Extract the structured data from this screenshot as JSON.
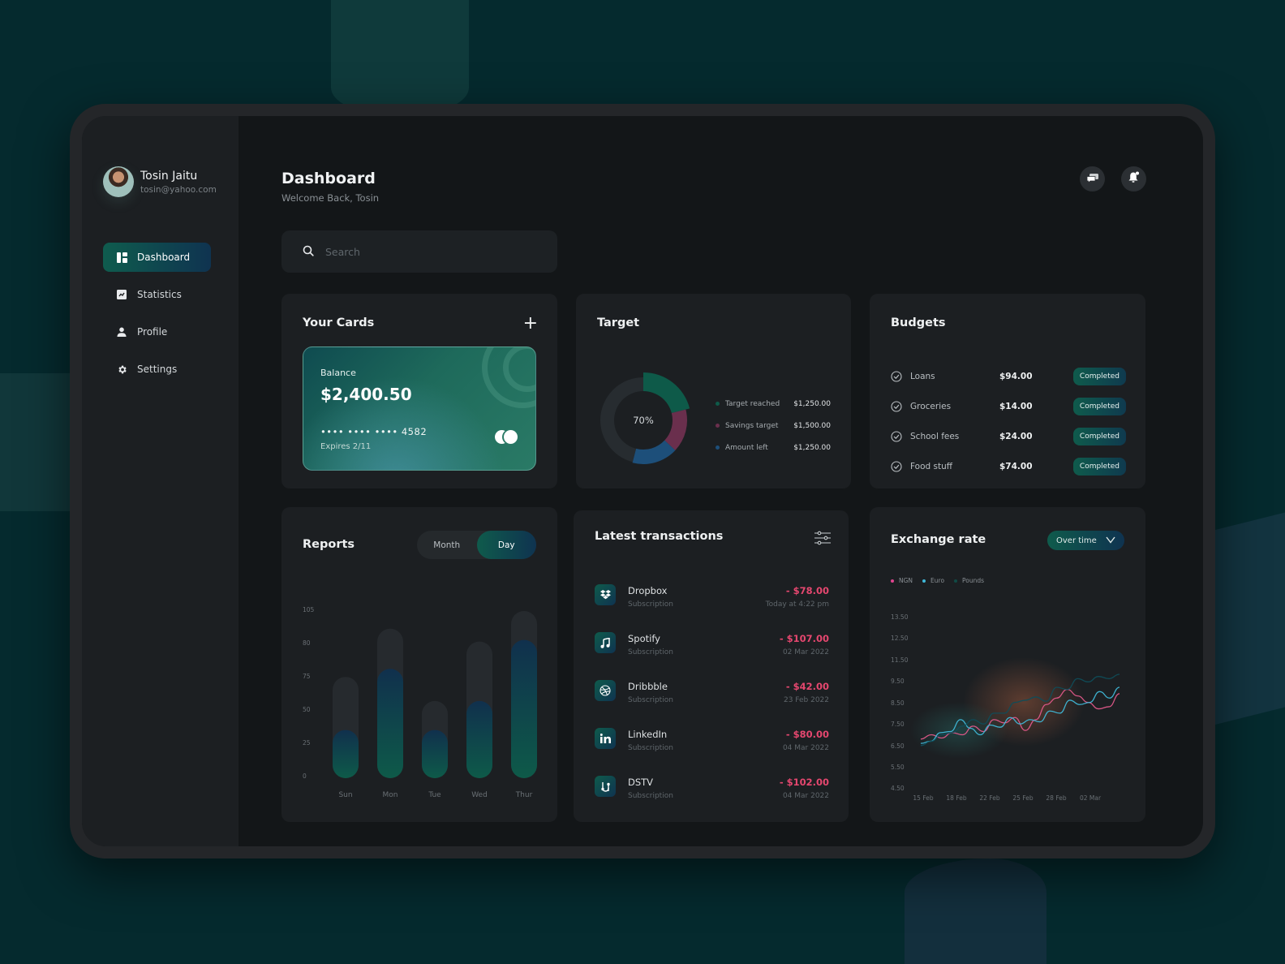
{
  "user": {
    "name": "Tosin Jaitu",
    "email": "tosin@yahoo.com"
  },
  "sidebar": {
    "items": [
      {
        "label": "Dashboard",
        "icon": "dashboard-icon",
        "active": true
      },
      {
        "label": "Statistics",
        "icon": "statistics-icon",
        "active": false
      },
      {
        "label": "Profile",
        "icon": "profile-icon",
        "active": false
      },
      {
        "label": "Settings",
        "icon": "settings-icon",
        "active": false
      }
    ]
  },
  "header": {
    "title": "Dashboard",
    "subtitle": "Welcome Back, Tosin",
    "icons": [
      "chat-icon",
      "notification-bell-icon"
    ]
  },
  "search": {
    "placeholder": "Search",
    "value": ""
  },
  "cards": {
    "title": "Your Cards",
    "add_label": "+",
    "card": {
      "balance_label": "Balance",
      "balance": "$2,400.50",
      "number": "•••• •••• •••• 4582",
      "expiry": "Expires 2/11",
      "brand_icon": "mastercard-icon"
    }
  },
  "target": {
    "title": "Target",
    "center_label": "70%",
    "legend": [
      {
        "label": "Target reached",
        "value": "$1,250.00",
        "color": "#0e5a49"
      },
      {
        "label": "Savings target",
        "value": "$1,500.00",
        "color": "#6a2f4d"
      },
      {
        "label": "Amount left",
        "value": "$1,250.00",
        "color": "#1d4f7a"
      }
    ],
    "segments": [
      {
        "name": "Target reached",
        "fraction": 0.21,
        "color": "#0e5a49",
        "offset": 0.0
      },
      {
        "name": "Savings target",
        "fraction": 0.16,
        "color": "#6a2f4d",
        "offset": 0.21
      },
      {
        "name": "Amount left",
        "fraction": 0.17,
        "color": "#1d4f7a",
        "offset": 0.37
      },
      {
        "name": "Remaining",
        "fraction": 0.46,
        "color": "#272c30",
        "offset": 0.54
      }
    ]
  },
  "budgets": {
    "title": "Budgets",
    "items": [
      {
        "name": "Loans",
        "amount": "$94.00",
        "status": "Completed"
      },
      {
        "name": "Groceries",
        "amount": "$14.00",
        "status": "Completed"
      },
      {
        "name": "School fees",
        "amount": "$24.00",
        "status": "Completed"
      },
      {
        "name": "Food stuff",
        "amount": "$74.00",
        "status": "Completed"
      }
    ]
  },
  "reports": {
    "title": "Reports",
    "toggle": [
      {
        "label": "Month",
        "active": false
      },
      {
        "label": "Day",
        "active": true
      }
    ]
  },
  "transactions": {
    "title": "Latest transactions",
    "items": [
      {
        "name": "Dropbox",
        "type": "Subscription",
        "amount": "- $78.00",
        "date": "Today at 4:22 pm",
        "icon": "dropbox-icon"
      },
      {
        "name": "Spotify",
        "type": "Subscription",
        "amount": "- $107.00",
        "date": "02 Mar 2022",
        "icon": "music-note-icon"
      },
      {
        "name": "Dribbble",
        "type": "Subscription",
        "amount": "- $42.00",
        "date": "23 Feb 2022",
        "icon": "dribbble-icon"
      },
      {
        "name": "LinkedIn",
        "type": "Subscription",
        "amount": "- $80.00",
        "date": "04 Mar 2022",
        "icon": "linkedin-icon"
      },
      {
        "name": "DSTV",
        "type": "Subscription",
        "amount": "- $102.00",
        "date": "04 Mar 2022",
        "icon": "dstv-icon"
      }
    ]
  },
  "exchange": {
    "title": "Exchange rate",
    "dropdown": "Over time"
  },
  "chart_data": [
    {
      "type": "bar",
      "title": "Reports",
      "categories": [
        "Sun",
        "Mon",
        "Tue",
        "Wed",
        "Thur"
      ],
      "y_ticks": [
        "105",
        "80",
        "75",
        "50",
        "25",
        "0"
      ],
      "series": [
        {
          "name": "total",
          "values": [
            63,
            93,
            48,
            85,
            104
          ]
        },
        {
          "name": "value",
          "values": [
            30,
            68,
            30,
            48,
            86
          ]
        }
      ],
      "colors": {
        "track": "#262a2e",
        "bar_top": "#10304d",
        "bar_bottom": "#0e5a49"
      }
    },
    {
      "type": "line",
      "title": "Exchange rate",
      "x_ticks": [
        "15 Feb",
        "18 Feb",
        "22 Feb",
        "25 Feb",
        "28 Feb",
        "02 Mar"
      ],
      "y_ticks": [
        "13.50",
        "12.50",
        "11.50",
        "9.50",
        "8.50",
        "7.50",
        "6.50",
        "5.50",
        "4.50"
      ],
      "legend": [
        {
          "name": "NGN",
          "color": "#e0458f"
        },
        {
          "name": "Euro",
          "color": "#3fb8d8"
        },
        {
          "name": "Pounds",
          "color": "#0f4a44"
        }
      ],
      "series": [
        {
          "name": "NGN",
          "color": "#e0588a",
          "values": [
            6.8,
            7.0,
            6.85,
            7.1,
            7.0,
            7.4,
            7.15,
            7.7,
            7.55,
            7.8,
            7.2,
            7.7,
            8.4,
            8.7,
            9.1,
            8.8,
            8.5,
            8.2,
            8.3,
            8.9
          ]
        },
        {
          "name": "Euro",
          "color": "#3fb8d8",
          "values": [
            6.6,
            6.7,
            7.1,
            7.15,
            7.7,
            7.3,
            7.0,
            7.45,
            7.35,
            7.8,
            7.5,
            7.7,
            7.6,
            8.1,
            8.0,
            8.6,
            8.4,
            8.5,
            9.0,
            8.7,
            9.2
          ]
        },
        {
          "name": "Pounds",
          "color": "#0f4d5a",
          "values": [
            6.5,
            6.7,
            7.0,
            7.1,
            7.4,
            7.7,
            7.5,
            8.0,
            8.0,
            8.5,
            8.6,
            8.75,
            8.55,
            9.2,
            9.1,
            9.6,
            9.45,
            9.7,
            9.6,
            9.8
          ]
        }
      ]
    }
  ]
}
